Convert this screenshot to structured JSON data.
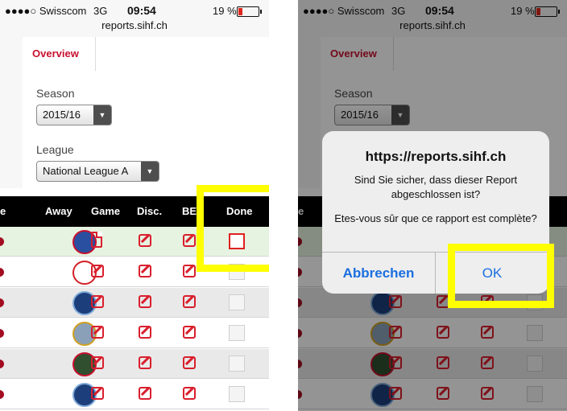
{
  "status": {
    "carrier": "●●●●○ Swisscom",
    "network": "3G",
    "time": "09:54",
    "battery": "19 %",
    "url": "reports.sihf.ch"
  },
  "tab": {
    "overview": "Overview"
  },
  "form": {
    "season_label": "Season",
    "season_value": "2015/16",
    "league_label": "League",
    "league_value": "National League A"
  },
  "table": {
    "headers": {
      "home_partial": "e",
      "away": "Away",
      "game": "Game",
      "disc": "Disc.",
      "ber": "BE",
      "done": "Done"
    }
  },
  "alert": {
    "title": "https://reports.sihf.ch",
    "message_de": "Sind Sie sicher, dass dieser Report abgeschlossen ist?",
    "message_fr": "Etes-vous sûr que ce rapport est complète?",
    "cancel": "Abbrechen",
    "ok": "OK"
  },
  "colors": {
    "accent": "#c8102e",
    "highlight": "#ffff00",
    "ios_blue": "#1a6fe0"
  }
}
